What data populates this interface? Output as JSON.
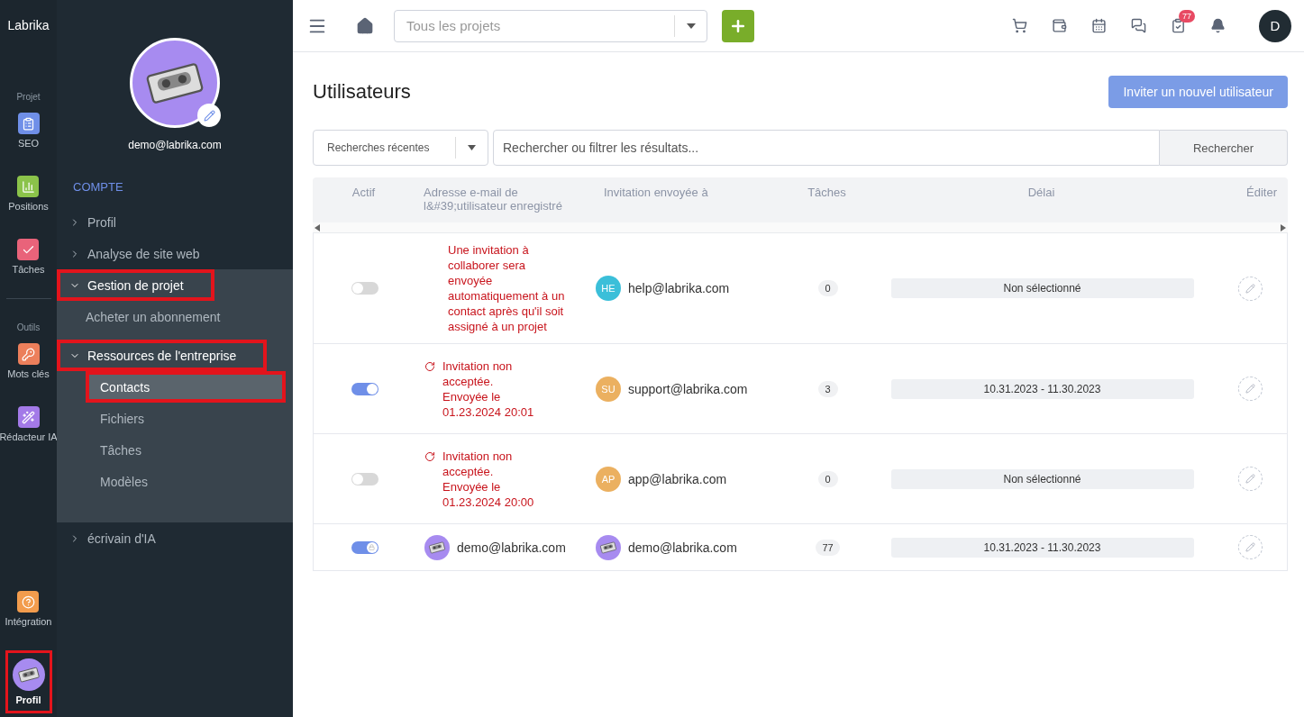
{
  "rail": {
    "logo": "Labrika",
    "sections": [
      {
        "label": "Projet",
        "items": [
          {
            "label": "SEO",
            "kind": "clipboard",
            "color": "#6f8fe8",
            "highlighted": false
          },
          {
            "label": "Positions",
            "kind": "chart",
            "color": "#8bc34a",
            "highlighted": false
          },
          {
            "label": "Tâches",
            "kind": "check",
            "color": "#e9637a",
            "highlighted": false
          }
        ]
      },
      {
        "label": "Outils",
        "items": [
          {
            "label": "Mots clés",
            "kind": "key",
            "color": "#ec7f5b",
            "highlighted": false
          },
          {
            "label": "Rédacteur IA",
            "kind": "wand",
            "color": "#a37ae8",
            "highlighted": false
          }
        ]
      }
    ],
    "bottom": [
      {
        "label": "Intégration",
        "kind": "help",
        "color": "#f29c4d",
        "highlighted": false
      },
      {
        "label": "Profil",
        "kind": "avatar",
        "color": "#a78bf0",
        "highlighted": true
      }
    ]
  },
  "sidebar": {
    "email": "demo@labrika.com",
    "section": "COMPTE",
    "items": [
      {
        "label": "Profil",
        "expanded": false,
        "highlighted": false
      },
      {
        "label": "Analyse de site web",
        "expanded": false,
        "highlighted": false
      },
      {
        "label": "Gestion de projet",
        "expanded": true,
        "highlighted": true,
        "children": [
          {
            "label": "Acheter un abonnement",
            "highlighted": false,
            "selected": false
          }
        ]
      },
      {
        "label": "Ressources de l'entreprise",
        "expanded": true,
        "highlighted": true,
        "children": [
          {
            "label": "Contacts",
            "highlighted": true,
            "selected": true
          },
          {
            "label": "Fichiers",
            "highlighted": false,
            "selected": false
          },
          {
            "label": "Tâches",
            "highlighted": false,
            "selected": false
          },
          {
            "label": "Modèles",
            "highlighted": false,
            "selected": false
          }
        ]
      },
      {
        "label": "écrivain d'IA",
        "expanded": false,
        "highlighted": false
      }
    ]
  },
  "topbar": {
    "project_placeholder": "Tous les projets",
    "tasks_badge": "77",
    "user_initial": "D"
  },
  "page": {
    "title": "Utilisateurs",
    "invite_button": "Inviter un nouvel utilisateur",
    "recent_searches": "Recherches récentes",
    "search_placeholder": "Rechercher ou filtrer les résultats...",
    "search_button": "Rechercher"
  },
  "table": {
    "columns": [
      "Actif",
      "Adresse e-mail de l&#39;utilisateur enregistré",
      "Invitation envoyée à",
      "Tâches",
      "Délai",
      "Éditer"
    ],
    "rows": [
      {
        "active": false,
        "registered": {
          "kind": "notice",
          "text": "Une invitation à collaborer sera envoyée automatiquement à un contact après qu'il soit assigné à un projet"
        },
        "invited": {
          "kind": "initials",
          "initials": "HE",
          "color": "#3bbfd9",
          "email": "help@labrika.com"
        },
        "tasks": "0",
        "period": "Non sélectionné"
      },
      {
        "active": true,
        "registered": {
          "kind": "pending",
          "text": "Invitation non acceptée. Envoyée le 01.23.2024 20:01"
        },
        "invited": {
          "kind": "initials",
          "initials": "SU",
          "color": "#ebb060",
          "email": "support@labrika.com"
        },
        "tasks": "3",
        "period": "10.31.2023 - 11.30.2023"
      },
      {
        "active": false,
        "registered": {
          "kind": "pending",
          "text": "Invitation non acceptée. Envoyée le 01.23.2024 20:00"
        },
        "invited": {
          "kind": "initials",
          "initials": "AP",
          "color": "#ebb060",
          "email": "app@labrika.com"
        },
        "tasks": "0",
        "period": "Non sélectionné"
      },
      {
        "active": true,
        "locked": true,
        "registered": {
          "kind": "user",
          "text": "demo@labrika.com"
        },
        "invited": {
          "kind": "avatar",
          "color": "#a78bf0",
          "email": "demo@labrika.com"
        },
        "tasks": "77",
        "period": "10.31.2023 - 11.30.2023"
      }
    ]
  }
}
